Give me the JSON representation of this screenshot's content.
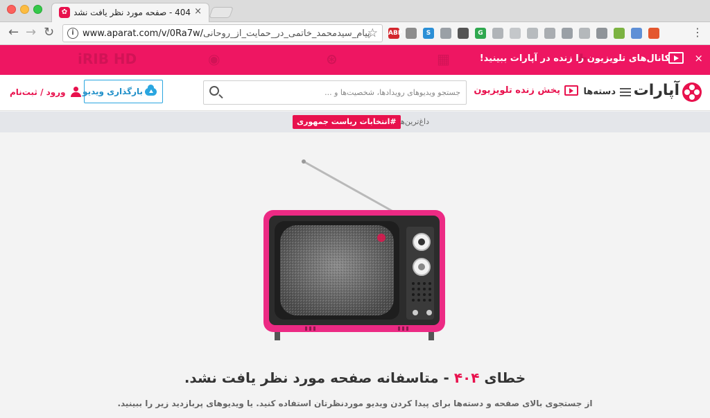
{
  "browser": {
    "tab_title": "404 - صفحه مورد نظر یافت نشد.",
    "tab_close": "×",
    "url_host": "www.aparat.com/v/0Ra7w/",
    "url_slug": "پیام_سیدمحمد_خاتمی_در_حمایت_از_روحانی",
    "back_glyph": "←",
    "forward_glyph": "→",
    "reload_glyph": "↻",
    "star_glyph": "☆",
    "menu_glyph": "⋮",
    "extensions": [
      {
        "label": "ABP",
        "color": "#d3262d"
      },
      {
        "label": "",
        "color": "#8c8c8c"
      },
      {
        "label": "S",
        "color": "#2b8fd6"
      },
      {
        "label": "",
        "color": "#9aa0a6"
      },
      {
        "label": "",
        "color": "#555555"
      },
      {
        "label": "G",
        "color": "#2fa84f"
      },
      {
        "label": "",
        "color": "#b0b4b8"
      },
      {
        "label": "",
        "color": "#c4c7ca"
      },
      {
        "label": "",
        "color": "#b7bbbe"
      },
      {
        "label": "",
        "color": "#a9adb1"
      },
      {
        "label": "",
        "color": "#9aa0a6"
      },
      {
        "label": "",
        "color": "#b4b8bb"
      },
      {
        "label": "",
        "color": "#8f9499"
      },
      {
        "label": "",
        "color": "#7cb342"
      },
      {
        "label": "",
        "color": "#5e8fd6"
      },
      {
        "label": "",
        "color": "#e4572e"
      }
    ]
  },
  "banner": {
    "text": "کانال‌های تلویزیون را زنده در آپارات ببینید!",
    "close": "×",
    "deco": [
      "iRIB HD",
      "◉",
      "⊛",
      "▦",
      "✚"
    ]
  },
  "header": {
    "logo_text": "آپارات",
    "categories_label": "دسته‌ها",
    "live_tv_label": "پخش زنده تلویزیون",
    "search_placeholder": "جستجو ویدیوهای رویدادها، شخصیت‌ها و ...",
    "upload_label": "بارگذاری ویدیو",
    "login_label": "ورود / ثبت‌نام"
  },
  "trending": {
    "label": "داغ‌ترین‌ها:",
    "tag": "#انتخابات ریاست جمهوری"
  },
  "error": {
    "prefix": "خطای",
    "code": "۴۰۴",
    "message": "- متاسفانه صفحه مورد نظر یافت نشد.",
    "description": "از جستجوی بالای صفحه و دسته‌ها برای پیدا کردن ویدیو موردنظرتان استفاده کنید. یا ویدیوهای پربازدید زیر را ببینید."
  },
  "colors": {
    "brand": "#e8114d",
    "banner": "#ee1662",
    "upload_blue": "#2aa6e0"
  }
}
